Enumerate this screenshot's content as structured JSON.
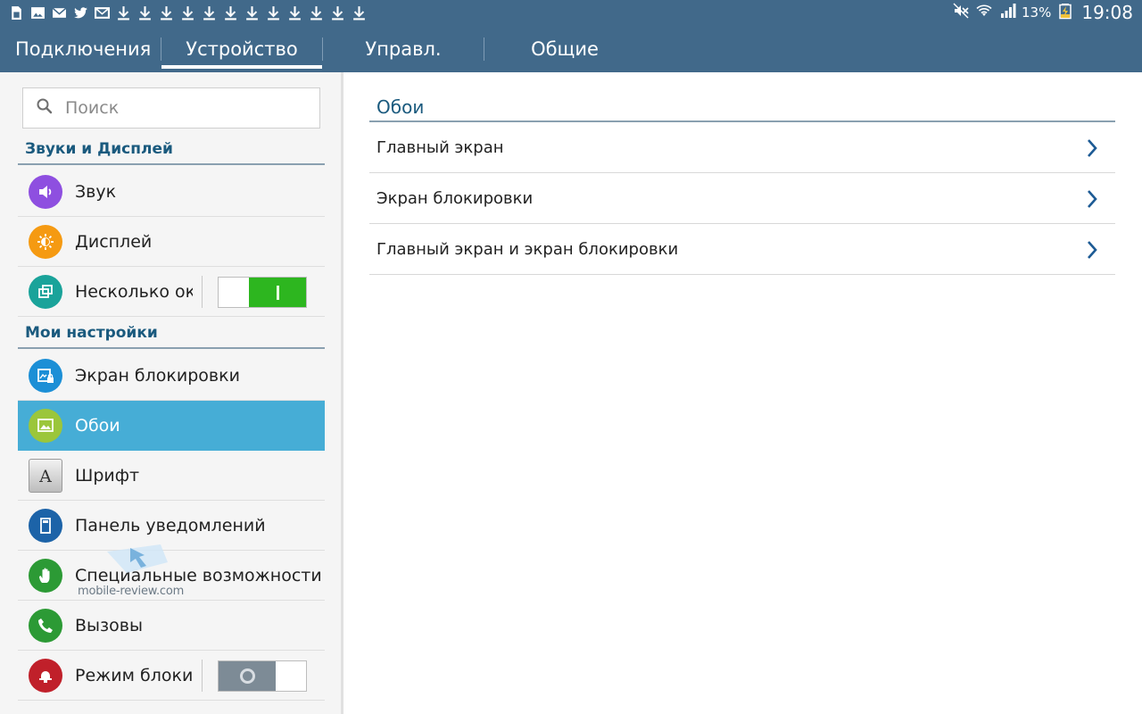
{
  "status_bar": {
    "left_icons": [
      "sim-card-icon",
      "image-icon",
      "email-icon",
      "twitter-icon",
      "mail-icon",
      "download-icon",
      "download-icon",
      "download-icon",
      "download-icon",
      "download-icon",
      "download-icon",
      "download-icon",
      "download-icon",
      "download-icon",
      "download-icon",
      "download-icon",
      "download-icon"
    ],
    "right_icons": [
      "mute-icon",
      "wifi-icon",
      "signal-icon",
      "charging-icon"
    ],
    "battery": "13%",
    "time": "19:08"
  },
  "tabs": [
    {
      "label": "Подключения"
    },
    {
      "label": "Устройство",
      "selected": true
    },
    {
      "label": "Управл."
    },
    {
      "label": "Общие"
    }
  ],
  "sidebar": {
    "search": {
      "placeholder": "Поиск",
      "value": ""
    },
    "sections": [
      {
        "header": "Звуки и Дисплей",
        "items": [
          {
            "label": "Звук",
            "icon": "speaker-icon",
            "color": "#8e4fe0"
          },
          {
            "label": "Дисплей",
            "icon": "brightness-icon",
            "color": "#f59a12"
          },
          {
            "label": "Несколько окон",
            "icon": "multi-window-icon",
            "color": "#1aa39a",
            "toggle": "on"
          }
        ]
      },
      {
        "header": "Мои настройки",
        "items": [
          {
            "label": "Экран блокировки",
            "icon": "lock-screen-icon",
            "color": "#1c8fd6"
          },
          {
            "label": "Обои",
            "icon": "wallpaper-icon",
            "color": "#9bc63b",
            "selected": true
          },
          {
            "label": "Шрифт",
            "icon": "font-icon",
            "color": "#d9d9d9"
          },
          {
            "label": "Панель уведомлений",
            "icon": "notification-panel-icon",
            "color": "#1c63a8"
          },
          {
            "label": "Специальные возможности",
            "icon": "accessibility-hand-icon",
            "color": "#2c9a35"
          },
          {
            "label": "Вызовы",
            "icon": "phone-icon",
            "color": "#2c9a35"
          },
          {
            "label": "Режим блокировки",
            "icon": "blocking-mode-icon",
            "color": "#c0202a",
            "toggle": "off"
          }
        ]
      }
    ]
  },
  "main": {
    "title": "Обои",
    "rows": [
      {
        "label": "Главный экран"
      },
      {
        "label": "Экран блокировки"
      },
      {
        "label": "Главный экран и экран блокировки"
      }
    ]
  },
  "watermark": {
    "text": "mobile-review.com"
  },
  "colors": {
    "header_bg": "#41698a",
    "accent_text": "#1a5a7e",
    "selected_bg": "#46add6",
    "toggle_on": "#2db61f",
    "toggle_off": "#7d8b96",
    "chevron": "#1c5a94"
  }
}
